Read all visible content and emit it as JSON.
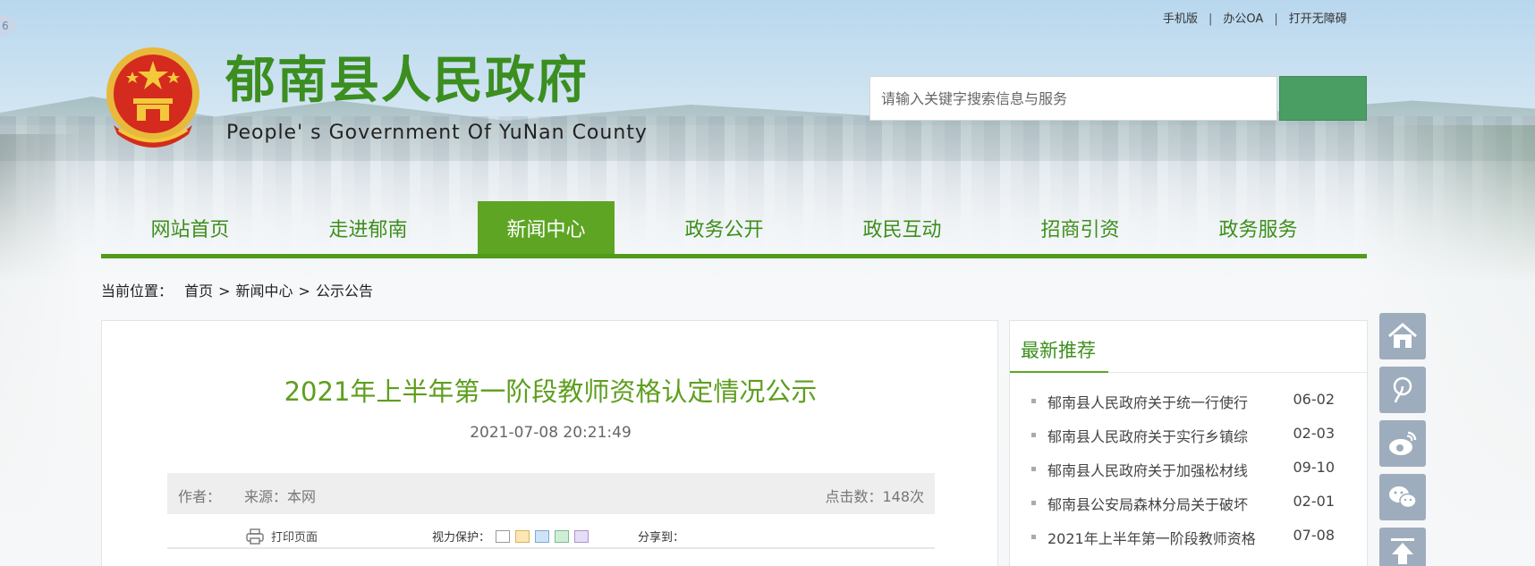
{
  "corner_badge": "6",
  "top_links": [
    "手机版",
    "办公OA",
    "打开无障碍"
  ],
  "top_links_sep": "|",
  "header": {
    "title": "郁南县人民政府",
    "subtitle": "People' s Government Of YuNan County"
  },
  "search": {
    "placeholder": "请输入关键字搜索信息与服务"
  },
  "nav": {
    "items": [
      "网站首页",
      "走进郁南",
      "新闻中心",
      "政务公开",
      "政民互动",
      "招商引资",
      "政务服务"
    ],
    "active_index": 2
  },
  "breadcrumb": {
    "label": "当前位置：",
    "items": [
      "首页",
      "新闻中心",
      "公示公告"
    ],
    "sep": ">"
  },
  "article": {
    "title": "2021年上半年第一阶段教师资格认定情况公示",
    "time": "2021-07-08 20:21:49",
    "author_label": "作者：",
    "source": "来源：本网",
    "clicks": "点击数：148次",
    "print_label": "打印页面",
    "vision_label": "视力保护：",
    "share_label": "分享到："
  },
  "vision_colors": [
    "#ffffff",
    "#fbe7b3",
    "#cfe3f8",
    "#cfeed8",
    "#e6ddf6"
  ],
  "sidebar": {
    "title": "最新推荐",
    "items": [
      {
        "text": "郁南县人民政府关于统一行使行",
        "date": "06-02"
      },
      {
        "text": "郁南县人民政府关于实行乡镇综",
        "date": "02-03"
      },
      {
        "text": "郁南县人民政府关于加强松材线",
        "date": "09-10"
      },
      {
        "text": "郁南县公安局森林分局关于破坏",
        "date": "02-01"
      },
      {
        "text": "2021年上半年第一阶段教师资格",
        "date": "07-08"
      }
    ]
  },
  "float_icons": [
    "home-icon",
    "tiktok-icon",
    "weibo-icon",
    "wechat-icon",
    "back-to-top-icon"
  ],
  "colors": {
    "brand_green": "#5ea524",
    "title_green": "#3b8e1f",
    "search_button": "#4a9e63",
    "float_button": "#9eadbd"
  }
}
